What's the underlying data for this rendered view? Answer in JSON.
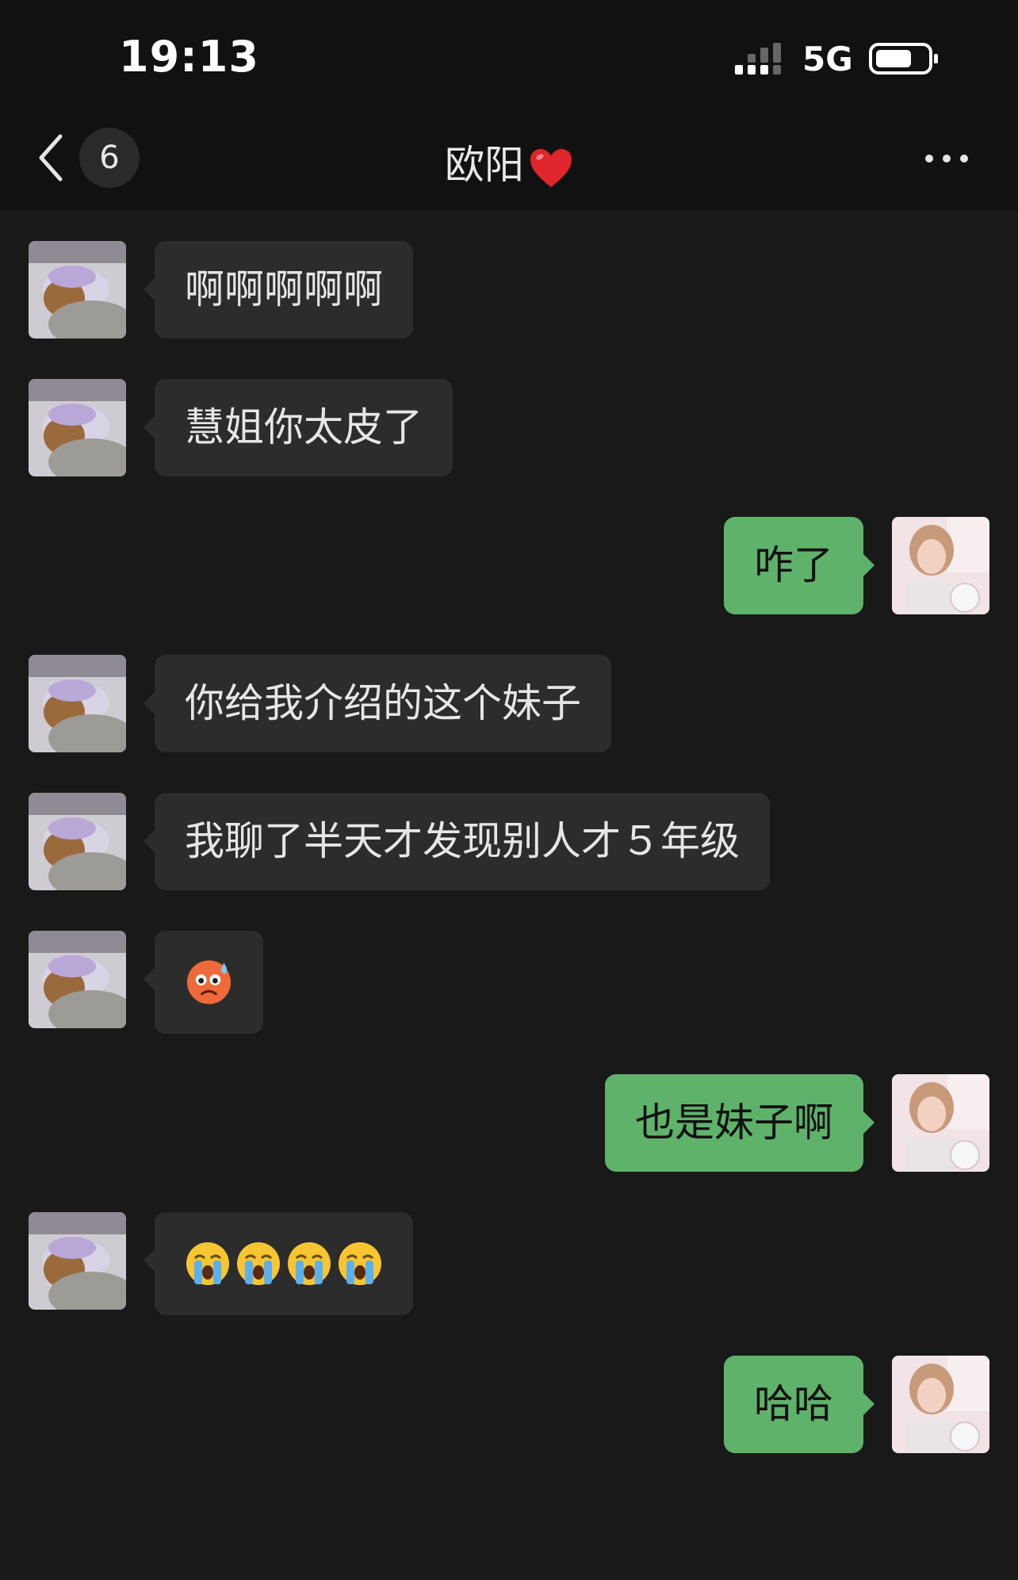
{
  "status_bar": {
    "time": "19:13",
    "network": "5G"
  },
  "nav": {
    "back_count": "6",
    "title": "欧阳"
  },
  "messages": [
    {
      "side": "in",
      "text": "啊啊啊啊啊"
    },
    {
      "side": "in",
      "text": "慧姐你太皮了"
    },
    {
      "side": "out",
      "text": "咋了"
    },
    {
      "side": "in",
      "text": "你给我介绍的这个妹子"
    },
    {
      "side": "in",
      "text": "我聊了半天才发现别人才５年级"
    },
    {
      "side": "in",
      "emoji": "sweat-face"
    },
    {
      "side": "out",
      "text": "也是妹子啊"
    },
    {
      "side": "in",
      "emoji": "loudly-crying-face x4"
    },
    {
      "side": "out",
      "text": "哈哈"
    }
  ],
  "colors": {
    "incoming_bubble": "#2c2c2c",
    "outgoing_bubble": "#5fb26a",
    "chat_background": "#191919"
  }
}
